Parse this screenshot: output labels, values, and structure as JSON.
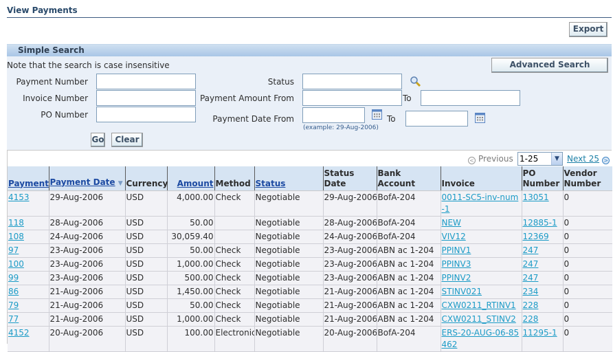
{
  "page": {
    "title": "View Payments"
  },
  "toolbar": {
    "export_label": "Export"
  },
  "search": {
    "header": "Simple Search",
    "note": "Note that the search is case insensitive",
    "advanced_label": "Advanced Search",
    "fields": {
      "payment_number": {
        "label": "Payment Number",
        "value": ""
      },
      "invoice_number": {
        "label": "Invoice Number",
        "value": ""
      },
      "po_number": {
        "label": "PO Number",
        "value": ""
      },
      "status": {
        "label": "Status",
        "value": ""
      },
      "amount_from": {
        "label": "Payment Amount From",
        "value": ""
      },
      "amount_to": {
        "label": "To",
        "value": ""
      },
      "date_from": {
        "label": "Payment Date From",
        "value": "",
        "hint": "(example: 29-Aug-2006)"
      },
      "date_to": {
        "label": "To",
        "value": ""
      }
    },
    "go_label": "Go",
    "clear_label": "Clear"
  },
  "pagination": {
    "previous_label": "Previous",
    "range": "1-25",
    "next_label": "Next 25"
  },
  "table": {
    "columns": [
      {
        "label": "Payment",
        "link": true
      },
      {
        "label": "Payment Date",
        "link": true,
        "sorted": "desc"
      },
      {
        "label": "Currency",
        "link": false
      },
      {
        "label": "Amount",
        "link": true
      },
      {
        "label": "Method",
        "link": false
      },
      {
        "label": "Status",
        "link": true
      },
      {
        "label": "Status Date",
        "link": false
      },
      {
        "label": "Bank Account",
        "link": false
      },
      {
        "label": "Invoice",
        "link": false
      },
      {
        "label": "PO Number",
        "link": false
      },
      {
        "label": "Vendor Number",
        "link": false
      }
    ],
    "rows": [
      {
        "payment": "4153",
        "date": "29-Aug-2006",
        "currency": "USD",
        "amount": "4,000.00",
        "method": "Check",
        "status": "Negotiable",
        "status_date": "29-Aug-2006",
        "bank": "BofA-204",
        "invoice": "0011-SC5-inv-num-1",
        "po": "13051",
        "vendor": "0"
      },
      {
        "payment": "118",
        "date": "28-Aug-2006",
        "currency": "USD",
        "amount": "50.00",
        "method": "",
        "status": "Negotiable",
        "status_date": "28-Aug-2006",
        "bank": "BofA-204",
        "invoice": "NEW",
        "po": "12885-1",
        "vendor": "0"
      },
      {
        "payment": "108",
        "date": "24-Aug-2006",
        "currency": "USD",
        "amount": "30,059.40",
        "method": "",
        "status": "Negotiable",
        "status_date": "24-Aug-2006",
        "bank": "BofA-204",
        "invoice": "VIV12",
        "po": "12369",
        "vendor": "0"
      },
      {
        "payment": "97",
        "date": "23-Aug-2006",
        "currency": "USD",
        "amount": "50.00",
        "method": "Check",
        "status": "Negotiable",
        "status_date": "23-Aug-2006",
        "bank": "ABN ac 1-204",
        "invoice": "PPINV1",
        "po": "247",
        "vendor": "0"
      },
      {
        "payment": "100",
        "date": "23-Aug-2006",
        "currency": "USD",
        "amount": "1,000.00",
        "method": "Check",
        "status": "Negotiable",
        "status_date": "23-Aug-2006",
        "bank": "ABN ac 1-204",
        "invoice": "PPINV3",
        "po": "247",
        "vendor": "0"
      },
      {
        "payment": "99",
        "date": "23-Aug-2006",
        "currency": "USD",
        "amount": "500.00",
        "method": "Check",
        "status": "Negotiable",
        "status_date": "23-Aug-2006",
        "bank": "ABN ac 1-204",
        "invoice": "PPINV2",
        "po": "247",
        "vendor": "0"
      },
      {
        "payment": "86",
        "date": "21-Aug-2006",
        "currency": "USD",
        "amount": "1,450.00",
        "method": "Check",
        "status": "Negotiable",
        "status_date": "21-Aug-2006",
        "bank": "ABN ac 1-204",
        "invoice": "STINV021",
        "po": "234",
        "vendor": "0"
      },
      {
        "payment": "79",
        "date": "21-Aug-2006",
        "currency": "USD",
        "amount": "50.00",
        "method": "Check",
        "status": "Negotiable",
        "status_date": "21-Aug-2006",
        "bank": "ABN ac 1-204",
        "invoice": "CXW0211_RTINV1",
        "po": "228",
        "vendor": "0"
      },
      {
        "payment": "77",
        "date": "21-Aug-2006",
        "currency": "USD",
        "amount": "1,000.00",
        "method": "Check",
        "status": "Negotiable",
        "status_date": "21-Aug-2006",
        "bank": "ABN ac 1-204",
        "invoice": "CXW0211_STINV2",
        "po": "228",
        "vendor": "0"
      },
      {
        "payment": "4152",
        "date": "20-Aug-2006",
        "currency": "USD",
        "amount": "100.00",
        "method": "Electronic",
        "status": "Negotiable",
        "status_date": "20-Aug-2006",
        "bank": "BofA-204",
        "invoice": "ERS-20-AUG-06-85462",
        "po": "11295-1",
        "vendor": "0"
      }
    ]
  }
}
